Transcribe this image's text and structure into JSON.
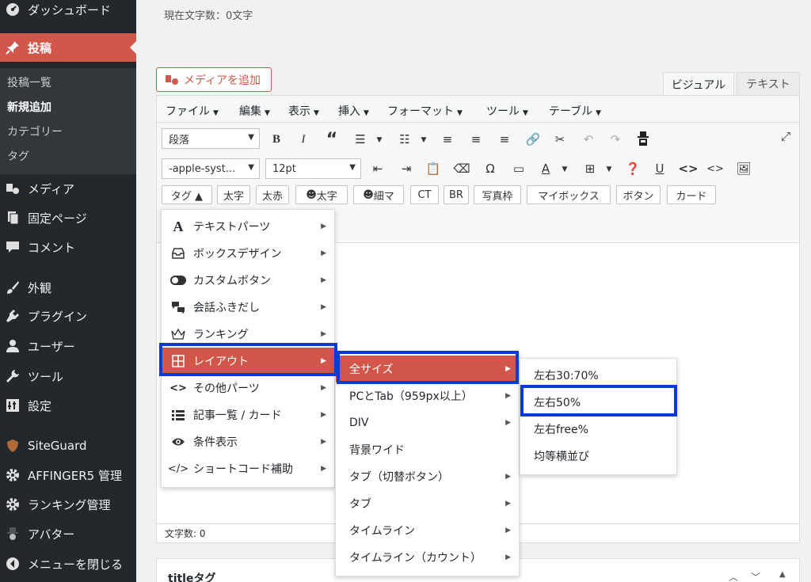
{
  "sidebar": {
    "dashboard": "ダッシュボード",
    "posts": "投稿",
    "posts_sub": [
      "投稿一覧",
      "新規追加",
      "カテゴリー",
      "タグ"
    ],
    "media": "メディア",
    "pages": "固定ページ",
    "comments": "コメント",
    "appearance": "外観",
    "plugins": "プラグイン",
    "users": "ユーザー",
    "tools": "ツール",
    "settings": "設定",
    "siteguard": "SiteGuard",
    "affinger": "AFFINGER5 管理",
    "ranking": "ランキング管理",
    "avatar": "アバター",
    "collapse": "メニューを閉じる"
  },
  "editor": {
    "char_counter": "現在文字数：0文字",
    "add_media": "メディアを追加",
    "tab_visual": "ビジュアル",
    "tab_text": "テキスト",
    "menus": [
      "ファイル",
      "編集",
      "表示",
      "挿入",
      "フォーマット",
      "ツール",
      "テーブル"
    ],
    "format_select": "段落",
    "font_select": "-apple-syst...",
    "size_select": "12pt",
    "quicktags": [
      "タグ ▲",
      "太字",
      "太赤",
      "太字",
      "細マ",
      "CT",
      "BR",
      "写真枠",
      "マイボックス",
      "ボタン",
      "カード"
    ],
    "status": "文字数: 0",
    "postbox_title": "titleタグ"
  },
  "menu1": [
    "テキストパーツ",
    "ボックスデザイン",
    "カスタムボタン",
    "会話ふきだし",
    "ランキング",
    "レイアウト",
    "その他パーツ",
    "記事一覧 / カード",
    "条件表示",
    "ショートコード補助"
  ],
  "menu2": [
    "全サイズ",
    "PCとTab（959px以上）",
    "DIV",
    "背景ワイド",
    "タブ（切替ボタン）",
    "タブ",
    "タイムライン",
    "タイムライン（カウント）"
  ],
  "menu3": [
    "左右30:70%",
    "左右50%",
    "左右free%",
    "均等横並び"
  ],
  "colors": {
    "accent": "#d0574a",
    "highlight": "#0a3ad6",
    "sidebar": "#23282d"
  }
}
